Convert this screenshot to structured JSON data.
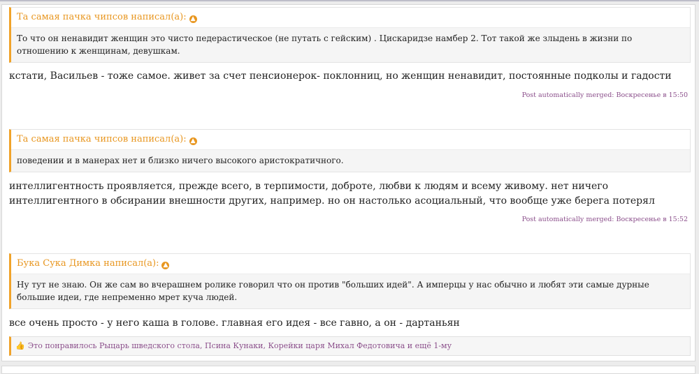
{
  "quotes": [
    {
      "author_line": "Та самая пачка чипсов написал(а):",
      "text": "То что он ненавидит женщин это чисто педерастическое (не путать с гейским) . Цискаридзе намбер 2. Тот такой же злыдень в жизни по отношению к женщинам, девушкам."
    },
    {
      "author_line": "Та самая пачка чипсов написал(а):",
      "text": "поведении и в манерах нет и близко ничего высокого аристократичного."
    },
    {
      "author_line": "Бука Сука Димка написал(а):",
      "text": "Ну тут не знаю. Он же сам во вчерашнем ролике говорил что он против \"больших идей\". А имперцы у нас обычно и любят эти самые дурные большие идеи, где непременно мрет куча людей."
    }
  ],
  "messages": [
    "кстати, Васильев - тоже самое. живет за счет пенсионерок- поклонниц, но женщин ненавидит, постоянные подколы и гадости",
    "интеллигентность проявляется, прежде всего, в терпимости, доброте, любви к людям и всему живому. нет ничего интеллигентного в обсирании внешности других, например. но он настолько асоциальный, что вообще уже берега потерял",
    "все очень просто - у него каша в голове. главная его идея - все гавно, а он - дартаньян"
  ],
  "merged_notes": [
    "Post automatically merged: Воскресенье в 15:50",
    "Post automatically merged: Воскресенье в 15:52"
  ],
  "likes": {
    "icon": "thumbs-up-icon",
    "text": "Это понравилось Рыцарь шведского стола, Псина Кунаки, Корейки царя Михал Федотовича и ещё 1-му"
  },
  "colors": {
    "accent": "#e8961f",
    "link": "#8b4f8b"
  }
}
